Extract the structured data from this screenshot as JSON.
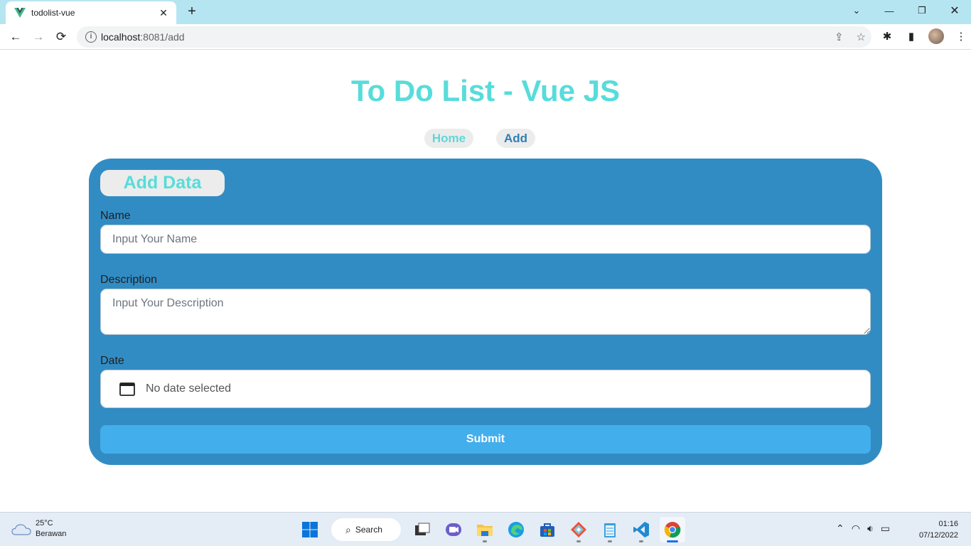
{
  "browser": {
    "tab_title": "todolist-vue",
    "url_host": "localhost",
    "url_path": ":8081/add"
  },
  "page": {
    "title": "To Do List - Vue JS",
    "nav": {
      "home": "Home",
      "add": "Add"
    }
  },
  "form": {
    "heading": "Add Data",
    "name_label": "Name",
    "name_placeholder": "Input Your Name",
    "description_label": "Description",
    "description_placeholder": "Input Your Description",
    "date_label": "Date",
    "date_value": "No date selected",
    "submit_label": "Submit"
  },
  "taskbar": {
    "temperature": "25°C",
    "weather": "Berawan",
    "search_label": "Search",
    "time": "01:16",
    "date": "07/12/2022"
  },
  "colors": {
    "title": "#57dcdb",
    "card": "#328cc4",
    "submit": "#43aeec",
    "nav_add": "#2f7fb5"
  }
}
